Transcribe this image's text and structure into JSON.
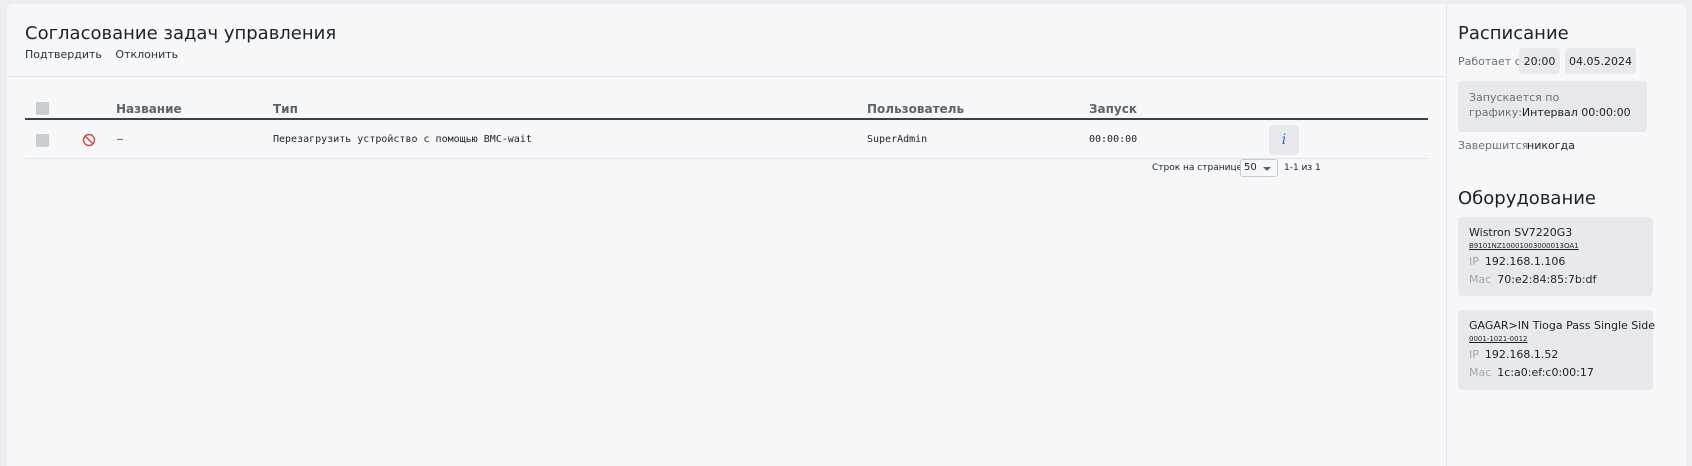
{
  "main": {
    "title": "Согласование задач управления",
    "actions": {
      "confirm": "Подтвердить",
      "reject": "Отклонить"
    },
    "table": {
      "columns": {
        "name": "Название",
        "type": "Тип",
        "user": "Пользователь",
        "start": "Запуск"
      },
      "rows": [
        {
          "name": "–",
          "type": "Перезагрузить устройство с помощью BMC-wait",
          "user": "SuperAdmin",
          "start": "00:00:00",
          "info": "i"
        }
      ]
    },
    "pagination": {
      "rows_label": "Строк на странице:",
      "rows_per_page": "50",
      "range": "1-1 из 1"
    }
  },
  "schedule": {
    "title": "Расписание",
    "works_from_label": "Работает с",
    "time": "20:00",
    "date": "04.05.2024",
    "runs_label": "Запускается по графику:",
    "runs_value": "Интервал 00:00:00",
    "ends_label": "Завершится",
    "ends_value": "никогда"
  },
  "equipment": {
    "title": "Оборудование",
    "items": [
      {
        "model": "Wistron  SV7220G3",
        "serial": "B9101NZ10001003000013OA1",
        "ip_label": "IP",
        "ip": "192.168.1.106",
        "mac_label": "Mac",
        "mac": "70:e2:84:85:7b:df"
      },
      {
        "model": "GAGAR>IN  Tioga Pass Single Side",
        "serial": "0001-1021-0012",
        "ip_label": "IP",
        "ip": "192.168.1.52",
        "mac_label": "Mac",
        "mac": "1c:a0:ef:c0:00:17"
      }
    ]
  },
  "colors": {
    "accent": "#3b63c9",
    "danger": "#d0473f",
    "background": "#f7f8fa"
  }
}
